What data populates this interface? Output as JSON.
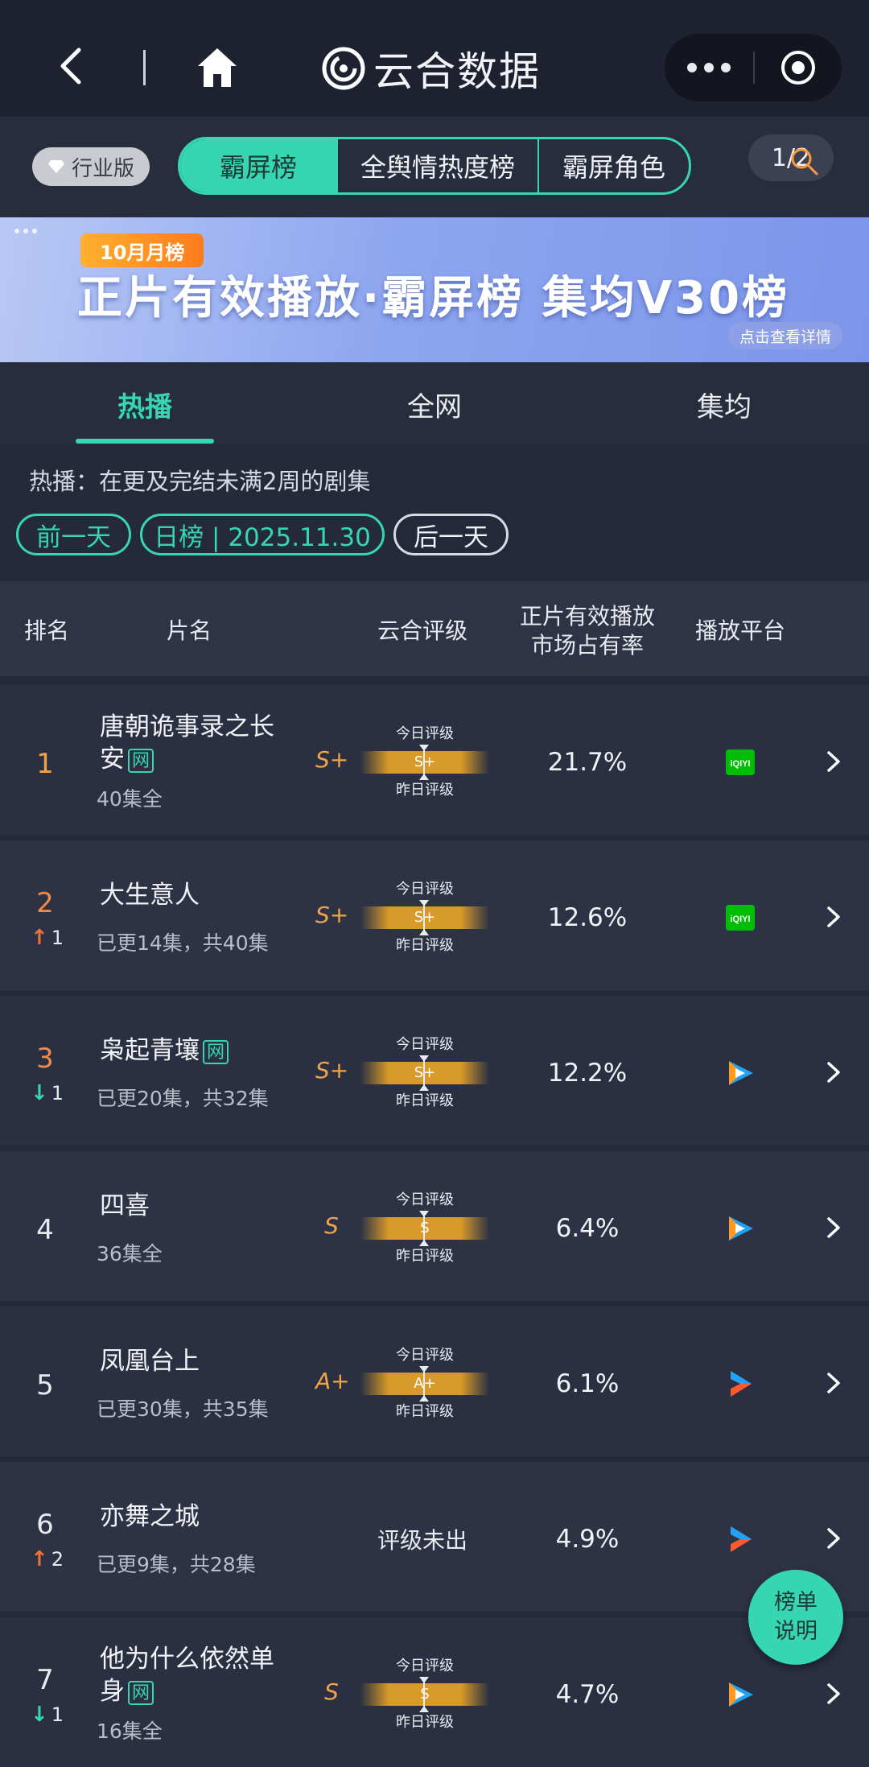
{
  "nav": {
    "brand": "云合数据",
    "back_icon": "chevron-left-icon",
    "home_icon": "home-icon",
    "more_icon": "more-dots-icon",
    "target_icon": "target-icon"
  },
  "filters": {
    "industry_badge": "行业版",
    "segments": [
      {
        "label": "霸屏榜",
        "active": true
      },
      {
        "label": "全舆情热度榜",
        "active": false
      },
      {
        "label": "霸屏角色",
        "active": false
      }
    ],
    "page_indicator": "1/2"
  },
  "banner": {
    "tag": "10月月榜",
    "title": "正片有效播放·霸屏榜 集均V30榜",
    "detail_button": "点击查看详情"
  },
  "tabs": [
    {
      "label": "热播",
      "active": true
    },
    {
      "label": "全网",
      "active": false
    },
    {
      "label": "集均",
      "active": false
    }
  ],
  "description": "热播：在更及完结未满2周的剧集",
  "date_nav": {
    "prev": "前一天",
    "current": "日榜 | 2025.11.30",
    "next": "后一天"
  },
  "table": {
    "headers": {
      "rank": "排名",
      "title": "片名",
      "rating": "云合评级",
      "share_line1": "正片有效播放",
      "share_line2": "市场占有率",
      "platform": "播放平台"
    },
    "rating_today_label": "今日评级",
    "rating_yesterday_label": "昨日评级",
    "rows": [
      {
        "rank": "1",
        "title": "唐朝诡事录之长安",
        "web": "网",
        "sub": "40集全",
        "change_dir": "",
        "change": "",
        "grade": "S+",
        "today": "S+",
        "share": "21.7%",
        "platform": "iqiyi"
      },
      {
        "rank": "2",
        "title": "大生意人",
        "web": "",
        "sub": "已更14集，共40集",
        "change_dir": "up",
        "change": "1",
        "grade": "S+",
        "today": "S+",
        "share": "12.6%",
        "platform": "iqiyi"
      },
      {
        "rank": "3",
        "title": "枭起青壤",
        "web": "网",
        "sub": "已更20集，共32集",
        "change_dir": "down",
        "change": "1",
        "grade": "S+",
        "today": "S+",
        "share": "12.2%",
        "platform": "tencent"
      },
      {
        "rank": "4",
        "title": "四喜",
        "web": "",
        "sub": "36集全",
        "change_dir": "",
        "change": "",
        "grade": "S",
        "today": "S",
        "share": "6.4%",
        "platform": "tencent"
      },
      {
        "rank": "5",
        "title": "凤凰台上",
        "web": "",
        "sub": "已更30集，共35集",
        "change_dir": "",
        "change": "",
        "grade": "A+",
        "today": "A+",
        "share": "6.1%",
        "platform": "youku"
      },
      {
        "rank": "6",
        "title": "亦舞之城",
        "web": "",
        "sub": "已更9集，共28集",
        "change_dir": "up",
        "change": "2",
        "grade": "",
        "today": "",
        "unrated": "评级未出",
        "share": "4.9%",
        "platform": "youku"
      },
      {
        "rank": "7",
        "title": "他为什么依然单身",
        "web": "网",
        "sub": "16集全",
        "change_dir": "down",
        "change": "1",
        "grade": "S",
        "today": "S",
        "share": "4.7%",
        "platform": "tencent"
      }
    ]
  },
  "help_button": {
    "line1": "榜单",
    "line2": "说明"
  },
  "colors": {
    "accent": "#36d6b3",
    "background": "#252a3a",
    "grade": "#f0a44a",
    "up": "#f0703c",
    "down": "#36d6b3",
    "iqiyi": "#00be06",
    "tencent_blue": "#1fa3f5",
    "youku_orange": "#ff5a2e"
  }
}
